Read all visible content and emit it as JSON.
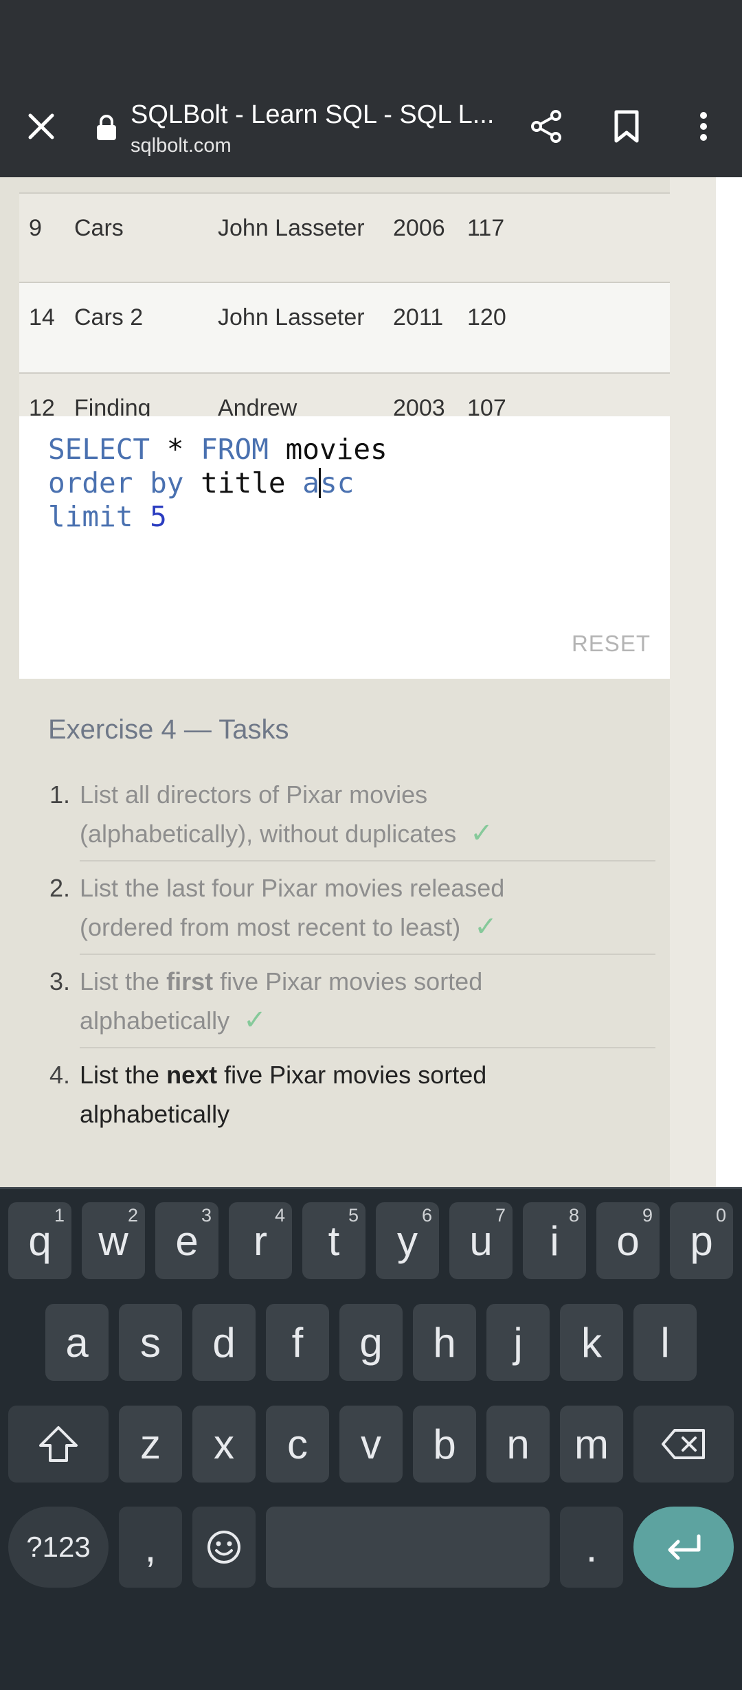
{
  "browser": {
    "title": "SQLBolt - Learn SQL - SQL L...",
    "url": "sqlbolt.com"
  },
  "table": {
    "rows": [
      {
        "id": "9",
        "title": "Cars",
        "director": "John Lasseter",
        "year": "2006",
        "length": "117"
      },
      {
        "id": "14",
        "title": "Cars 2",
        "director": "John Lasseter",
        "year": "2011",
        "length": "120"
      },
      {
        "id": "12",
        "title": "Finding",
        "director": "Andrew",
        "year": "2003",
        "length": "107"
      }
    ]
  },
  "editor": {
    "line1": {
      "kw1": "SELECT",
      "star": " * ",
      "kw2": "FROM",
      "rest": " movies"
    },
    "line2": {
      "kw1": "order by",
      "mid": " title ",
      "kw2a": "a",
      "kw2b": "sc"
    },
    "line3": {
      "kw": "limit",
      "num": "5"
    },
    "reset_label": "RESET"
  },
  "exercise": {
    "title": "Exercise 4 — Tasks",
    "tasks": [
      {
        "num": "1.",
        "line1": "List all directors of Pixar movies",
        "line2": "(alphabetically), without duplicates",
        "done": true
      },
      {
        "num": "2.",
        "line1": "List the last four Pixar movies released",
        "line2": "(ordered from most recent to least)",
        "done": true
      },
      {
        "num": "3.",
        "pre": "List the ",
        "bold": "first",
        "post": " five Pixar movies sorted",
        "line2": "alphabetically",
        "done": true
      },
      {
        "num": "4.",
        "pre": "List the ",
        "bold": "next",
        "post": " five Pixar movies sorted",
        "line2": "alphabetically",
        "done": false
      }
    ],
    "check_mark": "✓"
  },
  "keyboard": {
    "row1": [
      {
        "k": "q",
        "h": "1"
      },
      {
        "k": "w",
        "h": "2"
      },
      {
        "k": "e",
        "h": "3"
      },
      {
        "k": "r",
        "h": "4"
      },
      {
        "k": "t",
        "h": "5"
      },
      {
        "k": "y",
        "h": "6"
      },
      {
        "k": "u",
        "h": "7"
      },
      {
        "k": "i",
        "h": "8"
      },
      {
        "k": "o",
        "h": "9"
      },
      {
        "k": "p",
        "h": "0"
      }
    ],
    "row2": [
      "a",
      "s",
      "d",
      "f",
      "g",
      "h",
      "j",
      "k",
      "l"
    ],
    "row3": [
      "z",
      "x",
      "c",
      "v",
      "b",
      "n",
      "m"
    ],
    "symbols_label": "?123",
    "comma": ",",
    "period": "."
  }
}
